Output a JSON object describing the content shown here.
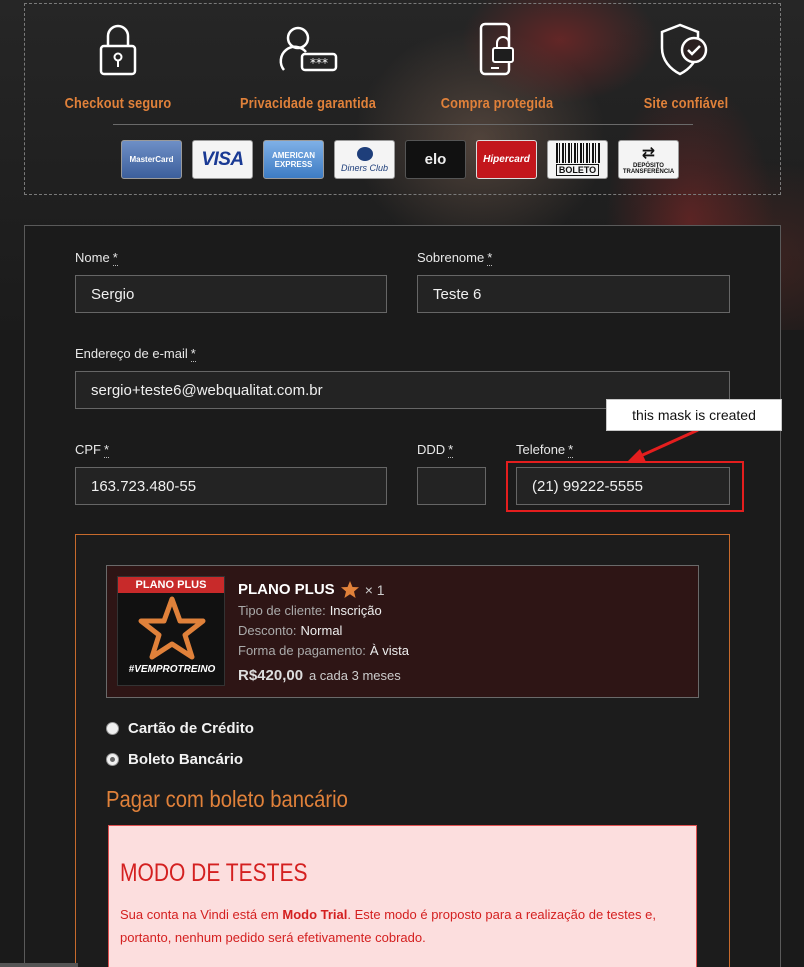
{
  "trust": {
    "items": [
      {
        "label": "Checkout seguro",
        "icon": "lock-icon"
      },
      {
        "label": "Privacidade garantida",
        "icon": "user-password-icon"
      },
      {
        "label": "Compra protegida",
        "icon": "phone-lock-icon"
      },
      {
        "label": "Site confiável",
        "icon": "shield-check-icon"
      }
    ],
    "accent_color": "#e0813a"
  },
  "payment_logos": {
    "mastercard": "MasterCard",
    "visa": "VISA",
    "amex_line1": "AMERICAN",
    "amex_line2": "EXPRESS",
    "diners": "Diners Club",
    "elo": "elo",
    "hipercard": "Hipercard",
    "boleto": "BOLETO",
    "deposito_line1": "DEPÓSITO",
    "deposito_line2": "TRANSFERÊNCIA"
  },
  "form": {
    "nome_label": "Nome",
    "nome_value": "Sergio",
    "sobrenome_label": "Sobrenome",
    "sobrenome_value": "Teste 6",
    "email_label": "Endereço de e-mail",
    "email_value": "sergio+teste6@webqualitat.com.br",
    "cpf_label": "CPF",
    "cpf_value": "163.723.480-55",
    "ddd_label": "DDD",
    "ddd_value": "",
    "telefone_label": "Telefone",
    "telefone_value": "(21) 99222-5555",
    "required_mark": "*"
  },
  "annotation": {
    "text": "this mask is created",
    "color": "#e41e1e"
  },
  "product": {
    "banner": "PLANO PLUS",
    "logo_text": "#VEMPROTREINO",
    "name": "PLANO PLUS",
    "qty": "× 1",
    "tipo_label": "Tipo de cliente:",
    "tipo_value": "Inscrição",
    "desconto_label": "Desconto:",
    "desconto_value": "Normal",
    "forma_label": "Forma de pagamento:",
    "forma_value": "À vista",
    "price": "R$420,00",
    "period": "a cada 3 meses"
  },
  "payment_methods": {
    "credit_card": "Cartão de Crédito",
    "boleto": "Boleto Bancário",
    "selected": "boleto"
  },
  "boleto_section": {
    "title": "Pagar com boleto bancário",
    "test_title": "MODO DE TESTES",
    "test_text_1": "Sua conta na Vindi está em ",
    "test_text_bold": "Modo Trial",
    "test_text_2": ". Este modo é proposto para a realização de testes e, portanto, nenhum pedido será efetivamente cobrado."
  }
}
